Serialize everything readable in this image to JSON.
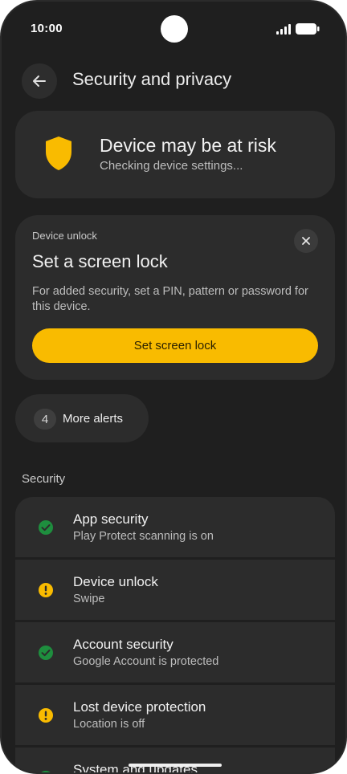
{
  "status_bar": {
    "time": "10:00"
  },
  "top_bar": {
    "title": "Security and privacy",
    "back_icon": "arrow-back-icon"
  },
  "risk_card": {
    "title": "Device may be at risk",
    "subtitle": "Checking device settings...",
    "icon": "shield-icon",
    "icon_color": "#f9bb00"
  },
  "screen_lock_card": {
    "eyebrow": "Device unlock",
    "title": "Set a screen lock",
    "description": "For added security, set a PIN, pattern or password for this device.",
    "button_label": "Set screen lock",
    "button_color": "#f9bb00",
    "dismiss_icon": "close-icon"
  },
  "alerts_chip": {
    "count": "4",
    "label": "More alerts"
  },
  "security_section": {
    "label": "Security",
    "items": [
      {
        "title": "App security",
        "subtitle": "Play Protect scanning is on",
        "status": "ok"
      },
      {
        "title": "Device unlock",
        "subtitle": "Swipe",
        "status": "warning"
      },
      {
        "title": "Account security",
        "subtitle": "Google Account is protected",
        "status": "ok"
      },
      {
        "title": "Lost device protection",
        "subtitle": "Location is off",
        "status": "warning"
      },
      {
        "title": "System and updates",
        "subtitle": "",
        "status": "ok"
      }
    ]
  },
  "colors": {
    "background": "#1f1f1f",
    "card": "#2c2c2c",
    "ok": "#1e8e3e",
    "warning": "#f9bb00"
  }
}
